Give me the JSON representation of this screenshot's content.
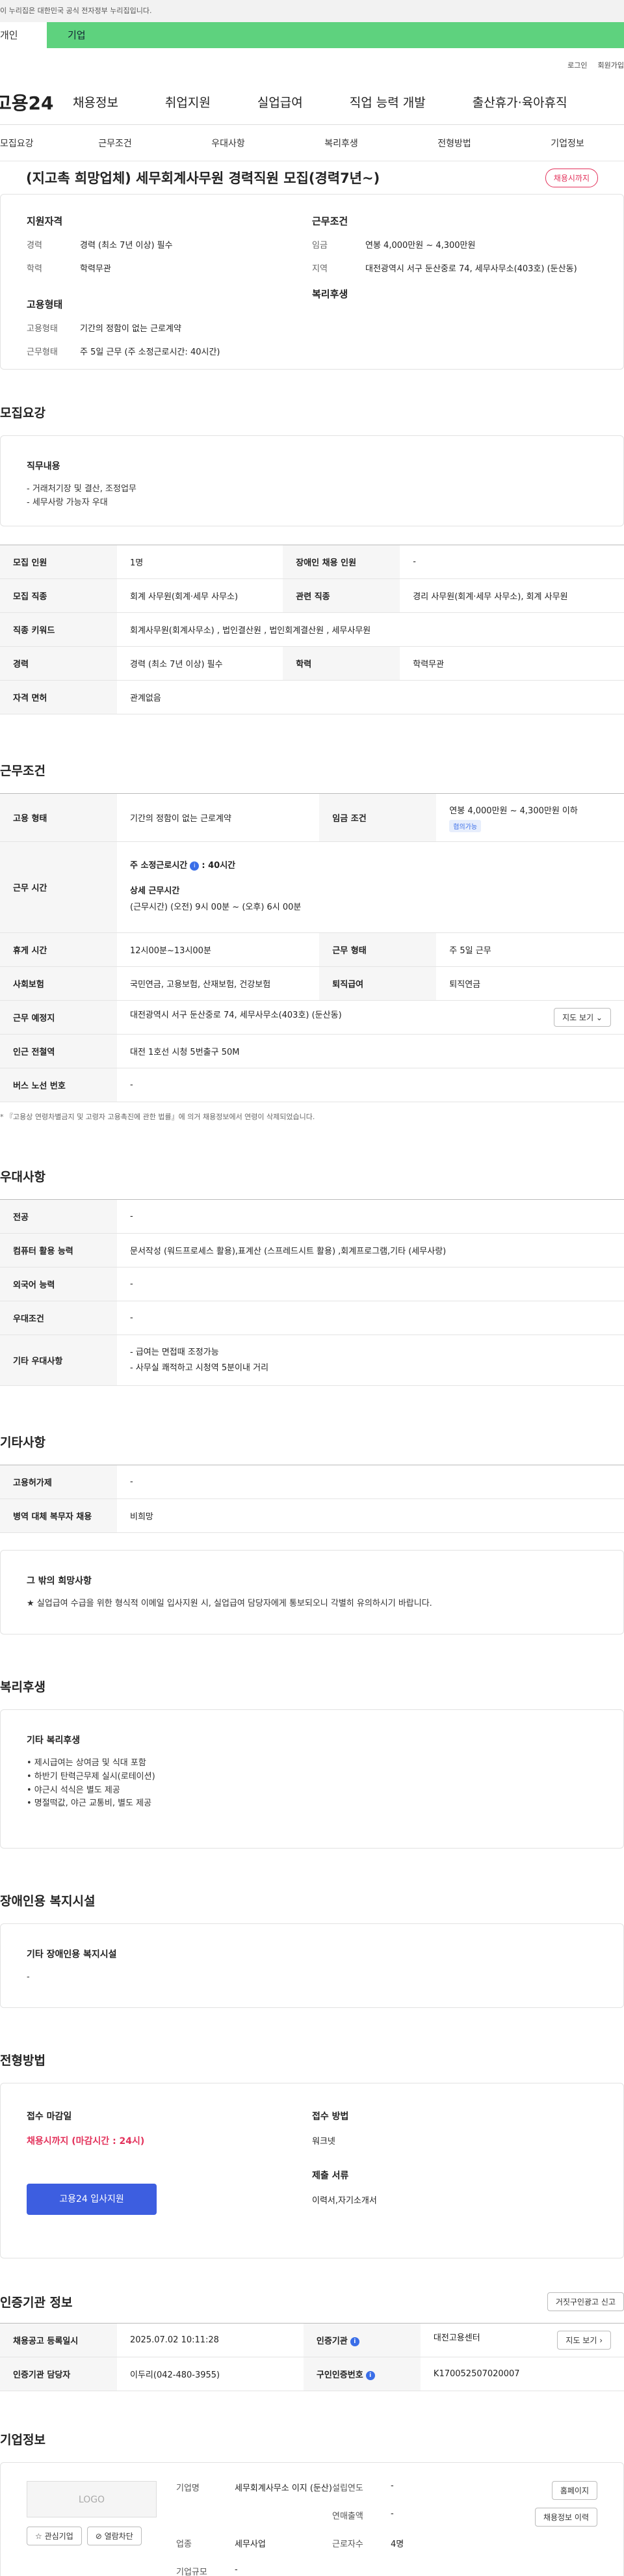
{
  "gov_banner": "이 누리집은 대한민국 공식 전자정부 누리집입니다.",
  "user_tabs": [
    "개인",
    "기업"
  ],
  "util": [
    "로그인",
    "회원가입"
  ],
  "logo": "고용24",
  "gnb": [
    "채용정보",
    "취업지원",
    "실업급여",
    "직업 능력 개발",
    "출산휴가·육아휴직"
  ],
  "subnav": [
    "모집요강",
    "근무조건",
    "우대사항",
    "복리후생",
    "전형방법",
    "기업정보"
  ],
  "title": "(지고촉 희망업체) 세무회계사무원 경력직원 모집(경력7년~)",
  "badge": "채용시까지",
  "summary": {
    "h_qual": "지원자격",
    "career_k": "경력",
    "career_v": "경력 (최소 7년 이상) 필수",
    "edu_k": "학력",
    "edu_v": "학력무관",
    "h_emp": "고용형태",
    "emptype_k": "고용형태",
    "emptype_v": "기간의 정함이 없는 근로계약",
    "work_k": "근무형태",
    "work_v": "주 5일 근무 (주 소정근로시간: 40시간)",
    "h_cond": "근무조건",
    "wage_k": "임금",
    "wage_v": "연봉 4,000만원 ~ 4,300만원",
    "region_k": "지역",
    "region_v": "대전광역시 서구 둔산중로 74, 세무사무소(403호) (둔산동)",
    "h_welfare": "복리후생"
  },
  "s_recruit": "모집요강",
  "duty": {
    "h": "직무내용",
    "l1": "- 거래처기장 및 결산, 조정업무",
    "l2": "- 세무사랑 가능자 우대"
  },
  "recruit_tbl": {
    "r1k": "모집 인원",
    "r1v": "1명",
    "r1k2": "장애인 채용 인원",
    "r1v2": "-",
    "r2k": "모집 직종",
    "r2v": "회계 사무원(회계·세무 사무소)",
    "r2k2": "관련 직종",
    "r2v2": "경리 사무원(회계·세무 사무소), 회계 사무원",
    "r3k": "직종 키워드",
    "r3v": "회계사무원(회계사무소) , 법인결산원 , 법인회계결산원 , 세무사무원",
    "r4k": "경력",
    "r4v": "경력 (최소 7년 이상) 필수",
    "r4k2": "학력",
    "r4v2": "학력무관",
    "r5k": "자격 면허",
    "r5v": "관계없음"
  },
  "s_cond": "근무조건",
  "cond_tbl": {
    "emp_k": "고용 형태",
    "emp_v": "기간의 정함이 없는 근로계약",
    "wage_k": "임금 조건",
    "wage_v": "연봉 4,000만원 ~ 4,300만원 이하",
    "wage_tag": "협의가능",
    "time_k": "근무 시간",
    "time_l1": "주 소정근로시간",
    "time_l1b": ": 40시간",
    "time_l2": "상세 근무시간",
    "time_l3": "(근무시간) (오전) 9시 00분 ~ (오후) 6시 00분",
    "rest_k": "휴게 시간",
    "rest_v": "12시00분~13시00분",
    "form_k": "근무 형태",
    "form_v": "주 5일 근무",
    "ins_k": "사회보험",
    "ins_v": "국민연금, 고용보험, 산재보험, 건강보험",
    "ret_k": "퇴직급여",
    "ret_v": "퇴직연금",
    "place_k": "근무 예정지",
    "place_v": "대전광역시 서구 둔산중로 74, 세무사무소(403호) (둔산동)",
    "map_btn": "지도 보기 ⌄",
    "sub_k": "인근 전철역",
    "sub_v": "대전 1호선 시청 5번출구 50M",
    "bus_k": "버스 노선 번호",
    "bus_v": "-"
  },
  "cond_note": "* 『고용상 연령차별금지 및 고령자 고용촉진에 관한 법률』에 의거 채용정보에서 연령이 삭제되었습니다.",
  "s_pref": "우대사항",
  "pref_tbl": {
    "major_k": "전공",
    "major_v": "-",
    "pc_k": "컴퓨터 활용 능력",
    "pc_v": "문서작성 (워드프로세스 활용),표계산 (스프레드시트 활용) ,회계프로그램,기타 (세무사랑)",
    "lang_k": "외국어 능력",
    "lang_v": "-",
    "cond_k": "우대조건",
    "cond_v": "-",
    "etc_k": "기타 우대사항",
    "etc_l1": "- 급여는 면접때 조정가능",
    "etc_l2": "- 사무실 쾌적하고 시청역 5분이내 거리"
  },
  "s_etc": "기타사항",
  "etc_tbl": {
    "hire_k": "고용허가제",
    "hire_v": "-",
    "mil_k": "병역 대체 복무자 채용",
    "mil_v": "비희망"
  },
  "hope": {
    "h": "그 밖의 희망사항",
    "v": "★ 실업급여 수급을 위한 형식적 이메일 입사지원 시, 실업급여 담당자에게 통보되오니 각별히 유의하시기 바랍니다."
  },
  "s_welfare": "복리후생",
  "welfare": {
    "h": "기타 복리후생",
    "l1": "• 제시급여는 상여금 및 식대 포함",
    "l2": "• 하반기 탄력근무제 실시(로테이션)",
    "l3": "• 야근시 석식은 별도 제공",
    "l4": "• 명절떡값, 야근 교통비, 별도 제공"
  },
  "s_dis": "장애인용 복지시설",
  "dis": {
    "h": "기타 장애인용 복지시설",
    "v": "-"
  },
  "s_apply": "전형방법",
  "apply": {
    "h1": "접수 마감일",
    "deadline": "채용시까지 (마감시간 : 24시)",
    "btn": "고용24 입사지원",
    "h2": "접수 방법",
    "method": "워크넷",
    "h3": "제출 서류",
    "docs": "이력서,자기소개서"
  },
  "s_agency": "인증기관 정보",
  "agency_btn": "거짓구인광고 신고",
  "agency_tbl": {
    "reg_k": "채용공고 등록일시",
    "reg_v": "2025.07.02 10:11:28",
    "org_k": "인증기관",
    "org_v": "대전고용센터",
    "map_btn": "지도 보기 ›",
    "mgr_k": "인증기관 담당자",
    "mgr_v": "이두리(042-480-3955)",
    "no_k": "구인인증번호",
    "no_v": "K170052507020007"
  },
  "s_company": "기업정보",
  "company": {
    "logo": "LOGO",
    "fav": "☆ 관심기업",
    "block": "⊘ 열람차단",
    "name_k": "기업명",
    "name_v": "세무회계사무소 이지 (둔산)",
    "ind_k": "업종",
    "ind_v": "세무사업",
    "size_k": "기업규모",
    "size_v": "-",
    "est_k": "설립연도",
    "est_v": "-",
    "sales_k": "연매출액",
    "sales_v": "-",
    "emp_k": "근로자수",
    "emp_v": "4명",
    "home_btn": "홈페이지",
    "hist_btn": "채용정보 이력"
  }
}
